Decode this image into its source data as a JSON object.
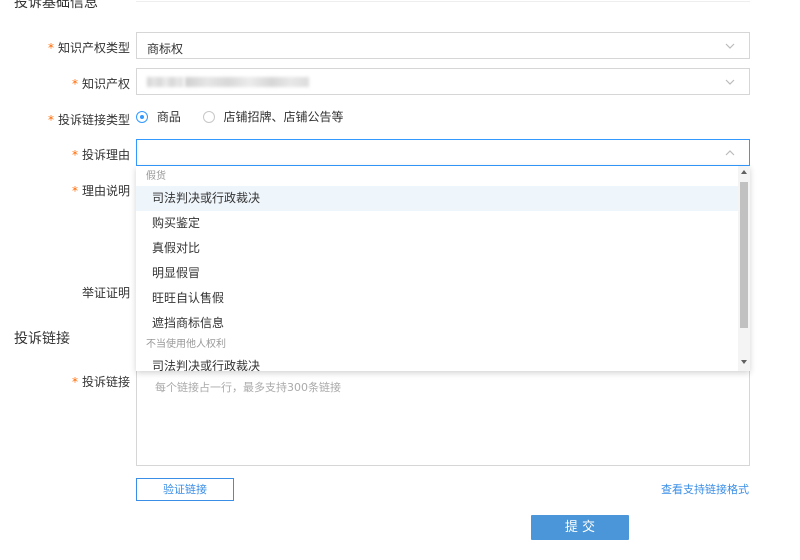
{
  "basic_info": {
    "title": "投诉基础信息",
    "ip_type": {
      "label": "知识产权类型",
      "value": "商标权"
    },
    "ip": {
      "label": "知识产权"
    },
    "link_type": {
      "label": "投诉链接类型",
      "options": [
        "商品",
        "店铺招牌、店铺公告等"
      ],
      "selected": "商品"
    },
    "reason": {
      "label": "投诉理由",
      "value": ""
    },
    "explanation": {
      "label": "理由说明"
    },
    "evidence": {
      "label": "举证证明"
    }
  },
  "reason_dropdown": {
    "groups": [
      {
        "name": "假货",
        "options": [
          "司法判决或行政裁决",
          "购买鉴定",
          "真假对比",
          "明显假冒",
          "旺旺自认售假",
          "遮挡商标信息"
        ]
      },
      {
        "name": "不当使用他人权利",
        "options": [
          "司法判决或行政裁决"
        ]
      }
    ],
    "highlighted": "司法判决或行政裁决"
  },
  "complaint_links": {
    "title": "投诉链接",
    "label": "投诉链接",
    "placeholder": "每个链接占一行，最多支持300条链接",
    "verify_button": "验证链接",
    "format_link": "查看支持链接格式"
  },
  "submit_button": "提 交",
  "colors": {
    "accent": "#3399ff",
    "required": "#ff6a00",
    "primary_button": "#4a96d8",
    "highlight_row": "#eef5fb"
  }
}
